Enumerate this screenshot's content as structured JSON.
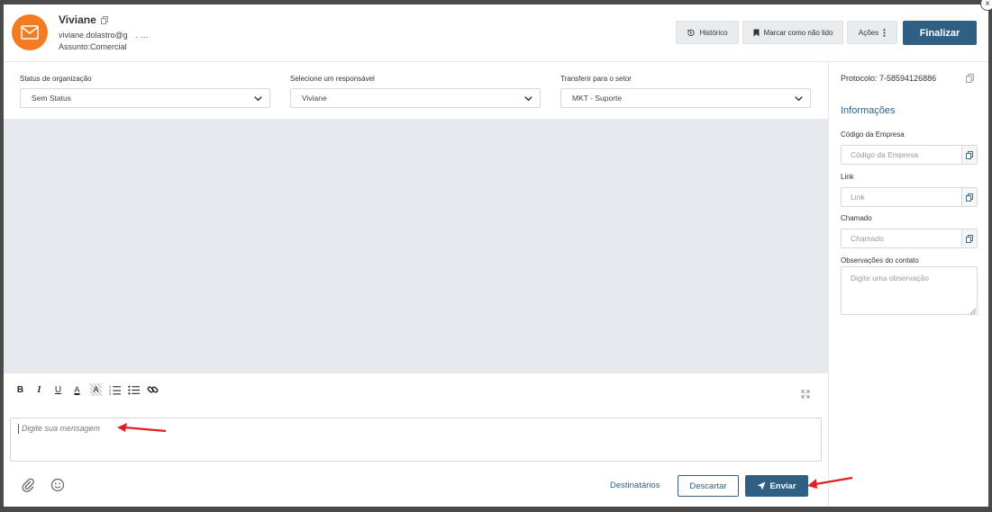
{
  "contact": {
    "name": "Viviane",
    "email": "viviane.dolastro@g",
    "email_hint": "․ ․․․",
    "subject": "Assunto:Comercial"
  },
  "header": {
    "historico": "Histórico",
    "marcar": "Marcar como não lido",
    "acoes": "Ações",
    "finalizar": "Finalizar"
  },
  "fields": {
    "status_label": "Status de organização",
    "status_value": "Sem Status",
    "responsavel_label": "Selecione um responsável",
    "responsavel_value": "Viviane",
    "setor_label": "Transferir para o setor",
    "setor_value": "MKT - Suporte"
  },
  "editor": {
    "toolbar": [
      "B",
      "I",
      "U",
      "A",
      "A"
    ],
    "placeholder": "Digite sua mensagem"
  },
  "footer": {
    "destinatarios": "Destinatários",
    "descartar": "Descartar",
    "enviar": "Enviar"
  },
  "panel": {
    "protocolo": "Protocolo: 7-58594126886",
    "info_title": "Informações",
    "codigo_label": "Código da Empresa",
    "codigo_placeholder": "Código da Empresa",
    "link_label": "Link",
    "link_placeholder": "Link",
    "chamado_label": "Chamado",
    "chamado_placeholder": "Chamado",
    "obs_label": "Observações do contato",
    "obs_placeholder": "Digite uma observação"
  },
  "colors": {
    "primary": "#2f5f82",
    "avatar": "#f47b20",
    "chat_bg": "#e5e8ec",
    "annotation": "#e02020"
  },
  "icons": {
    "avatar": "envelope-icon",
    "copy": "copy-icon",
    "history": "history-icon",
    "bookmark": "bookmark-icon",
    "more": "more-vertical-icon",
    "chevron": "chevron-down-icon",
    "attach": "paperclip-icon",
    "emoji": "smiley-icon",
    "send": "paper-plane-icon",
    "expand": "expand-icon",
    "close": "close-icon"
  }
}
